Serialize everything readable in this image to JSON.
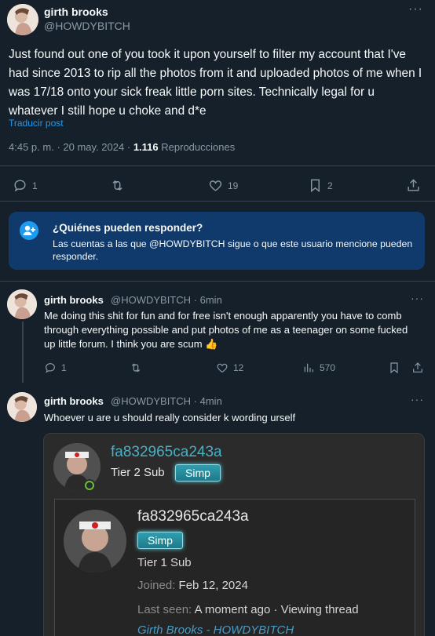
{
  "main_tweet": {
    "display_name": "girth brooks",
    "handle": "@HOWDYBITCH",
    "text": "Just found out one of you took it upon yourself to filter my account that I've had since 2013 to rip all the photos from it and uploaded photos of me when I was 17/18 onto your sick freak little porn sites. Technically legal for u whatever I still hope u choke and d*e",
    "translate_label": "Traducir post",
    "time": "4:45 p. m.",
    "date": "20 may. 2024",
    "views_count": "1.116",
    "views_label": "Reproducciones",
    "actions": {
      "replies": "1",
      "likes": "19",
      "bookmarks": "2"
    }
  },
  "who_can_reply": {
    "title": "¿Quiénes pueden responder?",
    "body": "Las cuentas a las que @HOWDYBITCH sigue o que este usuario mencione pueden responder."
  },
  "replies": [
    {
      "display_name": "girth brooks",
      "handle": "@HOWDYBITCH",
      "time": "6min",
      "text": "Me doing this shit for fun and for free isn't enough apparently you have to comb through everything possible and put photos of me as a teenager on some fucked up little forum. I think you are scum 👍",
      "actions": {
        "replies": "1",
        "likes": "12",
        "views": "570"
      }
    },
    {
      "display_name": "girth brooks",
      "handle": "@HOWDYBITCH",
      "time": "4min",
      "text": "Whoever u are u should really consider k wording urself"
    }
  ],
  "embed": {
    "username": "fa832965ca243a",
    "tier": "Tier 2 Sub",
    "badge": "Simp",
    "card": {
      "username": "fa832965ca243a",
      "badge": "Simp",
      "tier": "Tier 1 Sub",
      "joined_label": "Joined:",
      "joined_value": "Feb 12, 2024",
      "last_seen_label": "Last seen:",
      "last_seen_value": "A moment ago · Viewing thread",
      "link_text": "Girth Brooks - HOWDYBITCH"
    }
  },
  "separator_dot": "·",
  "more_glyph": "···",
  "colors": {
    "background": "#15202b",
    "accent": "#1d9bf0",
    "muted": "#8b98a5",
    "info_box": "#0f3a6b",
    "badge": "#2f9fb0"
  }
}
